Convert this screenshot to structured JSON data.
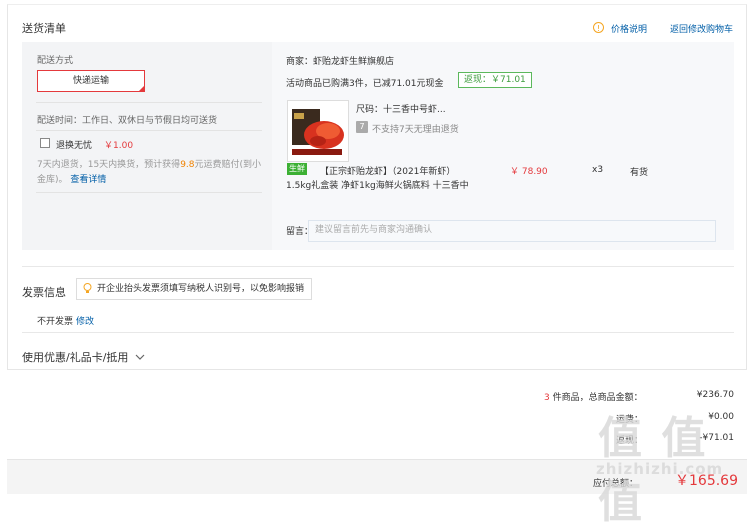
{
  "delivery": {
    "section_title": "送货清单",
    "price_note": "价格说明",
    "back_to_cart": "返回修改购物车",
    "shipping_method_label": "配送方式",
    "shipping_option": "快递运输",
    "delivery_time": "配送时间：工作日、双休日与节假日均可送货",
    "worry_free_label": "退换无忧",
    "worry_free_price": "￥1.00",
    "worry_free_desc_1": "7天内退货，15天内换货，预计获得",
    "worry_free_amount": "9.8",
    "worry_free_desc_2": "元运费赔付(到小",
    "worry_free_desc_3": "金库)。",
    "view_details": "查看详情"
  },
  "order": {
    "merchant": "商家：虾贻龙虾生鲜旗舰店",
    "promo": "活动商品已购满3件，已减71.01元现金",
    "cashback": "返现：￥71.01",
    "size_label": "尺码：十三香中号虾...",
    "no_return": "不支持7天无理由退货",
    "fresh_tag": "生鲜",
    "product_name_1": "【正宗虾贻龙虾】（2021年新虾）",
    "product_name_2": "1.5kg礼盒装 净虾1kg海鲜火锅底料 十三香中",
    "price": "￥ 78.90",
    "quantity": "x3",
    "stock": "有货",
    "memo_label": "留言：",
    "memo_placeholder": "建议留言前先与商家沟通确认"
  },
  "invoice": {
    "title": "发票信息",
    "tooltip": "开企业抬头发票须填写纳税人识别号，以免影响报销",
    "status": "不开发票",
    "modify": "修改"
  },
  "coupon": {
    "title": "使用优惠/礼品卡/抵用"
  },
  "summary": {
    "item_count": "3",
    "total_label": "件商品，总商品金额：",
    "total_value": "¥236.70",
    "shipping_label": "运费：",
    "shipping_value": "¥0.00",
    "discount_label": "返现：",
    "discount_value": "-¥71.01",
    "payable_label": "应付总额：",
    "payable_value": "￥165.69"
  },
  "watermark": {
    "glyphs": "值 值 值",
    "site": "zhizhizhi.com"
  }
}
